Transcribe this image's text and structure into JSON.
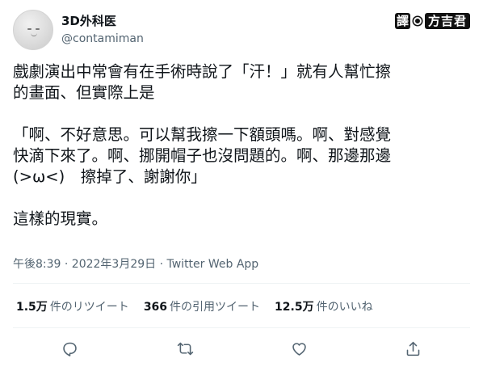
{
  "author": {
    "display_name": "3D外科医",
    "handle": "@contamiman"
  },
  "watermark": {
    "badge": "譯",
    "name": "方吉君"
  },
  "tweet": {
    "text": "戲劇演出中常會有在手術時說了「汗！」就有人幫忙擦\n的畫面、但實際上是\n\n「啊、不好意思。可以幫我擦一下額頭嗎。啊、對感覺\n快滴下來了。啊、挪開帽子也沒問題的。啊、那邊那邊\n(>ω<)　擦掉了、謝謝你」\n\n這樣的現實。",
    "timestamp": "午後8:39 · 2022年3月29日 · Twitter Web App"
  },
  "stats": [
    {
      "value": "1.5万",
      "label": "件のリツイート"
    },
    {
      "value": "366",
      "label": "件の引用ツイート"
    },
    {
      "value": "12.5万",
      "label": "件のいいね"
    }
  ],
  "icons": {
    "reply": "reply-icon",
    "retweet": "retweet-icon",
    "like": "like-icon",
    "share": "share-icon"
  },
  "colors": {
    "text": "#0f1419",
    "secondary": "#536471",
    "divider": "#eff3f4"
  }
}
